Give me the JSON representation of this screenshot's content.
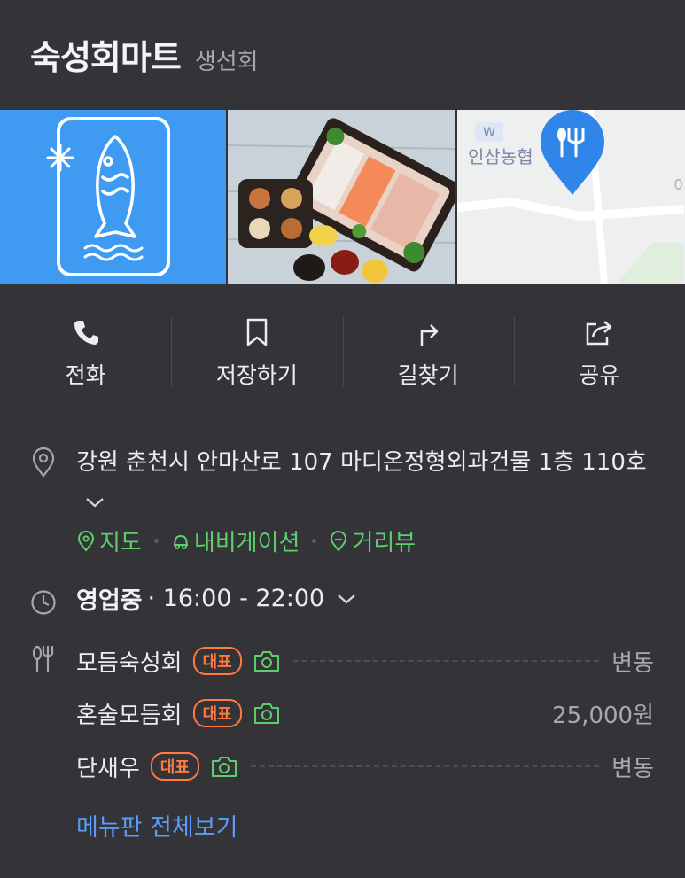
{
  "place": {
    "name": "숙성회마트",
    "category": "생선회"
  },
  "photos": [
    {
      "name": "logo-image"
    },
    {
      "name": "food-image"
    },
    {
      "name": "map-thumbnail",
      "map_label": "인삼농협"
    }
  ],
  "actions": [
    {
      "label": "전화",
      "icon": "phone-icon"
    },
    {
      "label": "저장하기",
      "icon": "bookmark-icon"
    },
    {
      "label": "길찾기",
      "icon": "directions-icon"
    },
    {
      "label": "공유",
      "icon": "share-icon"
    }
  ],
  "address": {
    "text": "강원 춘천시 안마산로 107 마디온정형외과건물 1층 110호"
  },
  "links": [
    {
      "label": "지도",
      "icon": "map-pin-icon"
    },
    {
      "label": "내비게이션",
      "icon": "car-icon"
    },
    {
      "label": "거리뷰",
      "icon": "street-view-icon"
    }
  ],
  "hours": {
    "status": "영업중",
    "time": "· 16:00 - 22:00"
  },
  "menu": {
    "items": [
      {
        "name": "모듬숙성회",
        "badge": "대표",
        "price": "변동"
      },
      {
        "name": "혼술모듬회",
        "badge": "대표",
        "price": "25,000원"
      },
      {
        "name": "단새우",
        "badge": "대표",
        "price": "변동"
      }
    ],
    "view_all": "메뉴판 전체보기"
  },
  "colors": {
    "background": "#333338",
    "link_green": "#5ccf6b",
    "badge_orange": "#ff7a3d",
    "accent_blue": "#5b9cf5",
    "logo_blue": "#3f9bf2"
  }
}
